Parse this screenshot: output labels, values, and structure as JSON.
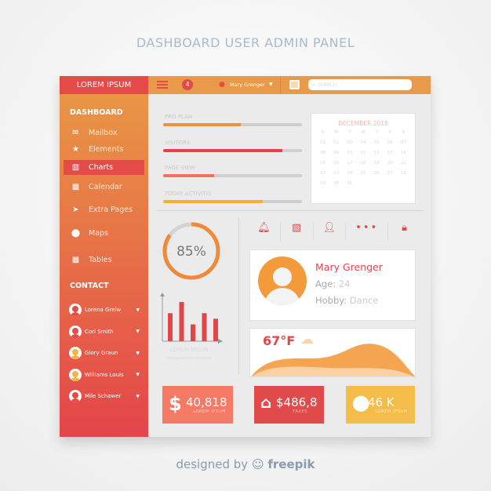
{
  "title": "DASHBOARD USER ADMIN PANEL",
  "sidebar": {
    "logo": "LOREM IPSUM",
    "dashboard_heading": "DASHBOARD",
    "items": [
      {
        "label": "Mailbox",
        "icon": "mail-icon"
      },
      {
        "label": "Elements",
        "icon": "star-icon"
      },
      {
        "label": "Charts",
        "icon": "bar-chart-icon",
        "active": true
      },
      {
        "label": "Calendar",
        "icon": "calendar-icon"
      },
      {
        "label": "Extra Pages",
        "icon": "paper-plane-icon"
      },
      {
        "label": "Maps",
        "icon": "map-pin-icon"
      },
      {
        "label": "Tables",
        "icon": "grid-icon"
      }
    ],
    "contact_heading": "CONTACT",
    "contacts": [
      {
        "name": "Lorena Greiw",
        "color": "#e34a48"
      },
      {
        "name": "Cori Smith",
        "color": "#e34a48"
      },
      {
        "name": "Glory Graun",
        "color": "#f2b443"
      },
      {
        "name": "Williams Louis",
        "color": "#f2b443"
      },
      {
        "name": "Mile Schawer",
        "color": "#e34a48"
      }
    ]
  },
  "topbar": {
    "notifications": "4",
    "user": "Mary Grenger",
    "search_placeholder": "SEARCH"
  },
  "progress": [
    {
      "label": "PRO PLAN",
      "value": 0.56,
      "color": "#f0923a"
    },
    {
      "label": "VISITORS",
      "value": 0.86,
      "color": "#e8404a"
    },
    {
      "label": "PAGE VIEW",
      "value": 0.37,
      "color": "#f27060"
    },
    {
      "label": "TODAY ACTIVITIS",
      "value": 0.72,
      "color": "#f6b02c"
    }
  ],
  "calendar": {
    "title": "DECEMBER 2018",
    "weekdays": [
      "S",
      "M",
      "T",
      "W",
      "T",
      "F",
      "S"
    ],
    "days": [
      "01",
      "02",
      "03",
      "04",
      "05",
      "06",
      "07",
      "08",
      "09",
      "10",
      "11",
      "12",
      "13",
      "14",
      "15",
      "16",
      "17",
      "18",
      "19",
      "20",
      "21",
      "22",
      "23",
      "24",
      "25",
      "26",
      "27",
      "28",
      "29",
      "30",
      "31"
    ]
  },
  "donut": {
    "value": 85,
    "label": "85%"
  },
  "bar_chart": {
    "values": [
      5,
      7,
      3,
      5,
      4
    ],
    "caption": "LOREM IPSUM",
    "subcaption": "designdesigndesigne"
  },
  "icons": [
    "bell-icon",
    "image-icon",
    "add-user-icon",
    "more-icon",
    "lock-icon"
  ],
  "profile": {
    "name": "Mary Grenger",
    "age_label": "Age:",
    "age": "24",
    "hobby_label": "Hobby:",
    "hobby": "Dance"
  },
  "weather": {
    "temp": "67°F"
  },
  "stats": [
    {
      "value": "40,818",
      "label": "LOREM IPSUM",
      "icon": "dollar-icon",
      "color": "#f47a66"
    },
    {
      "value": "$486,8",
      "label": "TAXES",
      "icon": "home-icon",
      "color": "#e04a4a"
    },
    {
      "value": "46 K",
      "label": "LOREM IPSUM",
      "icon": "map-pin-icon",
      "color": "#f4bd4a"
    }
  ],
  "footer": {
    "prefix": "designed by",
    "brand": "freepik"
  }
}
